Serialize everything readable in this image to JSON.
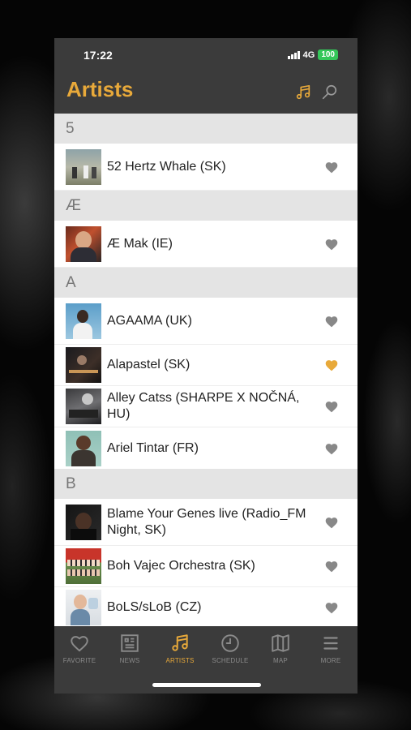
{
  "status_bar": {
    "time": "17:22",
    "network": "4G",
    "battery": "100"
  },
  "header": {
    "title": "Artists"
  },
  "sections": [
    {
      "letter": "5",
      "artists": [
        {
          "name": "52 Hertz Whale (SK)",
          "favorite": false
        }
      ]
    },
    {
      "letter": "Æ",
      "artists": [
        {
          "name": "Æ Mak (IE)",
          "favorite": false
        }
      ]
    },
    {
      "letter": "A",
      "artists": [
        {
          "name": "AGAAMA (UK)",
          "favorite": false
        },
        {
          "name": "Alapastel (SK)",
          "favorite": true
        },
        {
          "name": "Alley Catss (SHARPE X NOČNÁ, HU)",
          "favorite": false
        },
        {
          "name": "Ariel Tintar (FR)",
          "favorite": false
        }
      ]
    },
    {
      "letter": "B",
      "artists": [
        {
          "name": "Blame Your Genes live (Radio_FM Night, SK)",
          "favorite": false
        },
        {
          "name": "Boh Vajec Orchestra (SK)",
          "favorite": false
        },
        {
          "name": "BoLS/sLoB (CZ)",
          "favorite": false
        }
      ]
    }
  ],
  "tabs": [
    {
      "label": "FAVORITE",
      "icon": "heart-icon",
      "active": false
    },
    {
      "label": "NEWS",
      "icon": "news-icon",
      "active": false
    },
    {
      "label": "ARTISTS",
      "icon": "music-note-icon",
      "active": true
    },
    {
      "label": "SCHEDULE",
      "icon": "clock-icon",
      "active": false
    },
    {
      "label": "MAP",
      "icon": "map-icon",
      "active": false
    },
    {
      "label": "MORE",
      "icon": "menu-icon",
      "active": false
    }
  ],
  "colors": {
    "accent": "#e8a93a",
    "heart_inactive": "#888888",
    "bar": "#3b3b3b"
  }
}
